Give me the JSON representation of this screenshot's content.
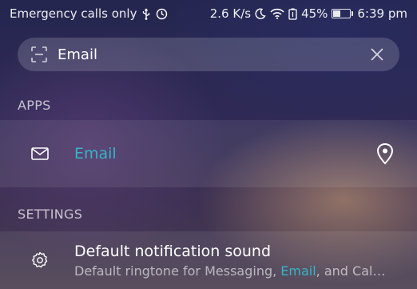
{
  "status_bar": {
    "carrier_text": "Emergency calls only",
    "usb_icon": "usb-icon",
    "sync_icon": "sync-icon",
    "network_speed": "2.6 K/s",
    "moon_icon": "moon-icon",
    "wifi_icon": "wifi-icon",
    "battery_saver_icon": "battery-saver-icon",
    "battery_percent": "45%",
    "battery_level": 0.45,
    "time": "6:39 pm"
  },
  "search": {
    "scan_icon": "scan-icon",
    "value": "Email",
    "clear_icon": "close-icon"
  },
  "sections": {
    "apps_header": "APPS",
    "settings_header": "SETTINGS"
  },
  "apps": [
    {
      "icon": "mail-icon",
      "title": "Email",
      "action_icon": "location-pin-icon"
    }
  ],
  "settings": [
    {
      "icon": "gear-icon",
      "title": "Default notification sound",
      "subtitle_prefix": "Default ringtone for Messaging, ",
      "subtitle_highlight": "Email",
      "subtitle_suffix": ", and Cal…"
    }
  ],
  "colors": {
    "accent": "#35b4c8",
    "caret": "#2b8fe8"
  }
}
